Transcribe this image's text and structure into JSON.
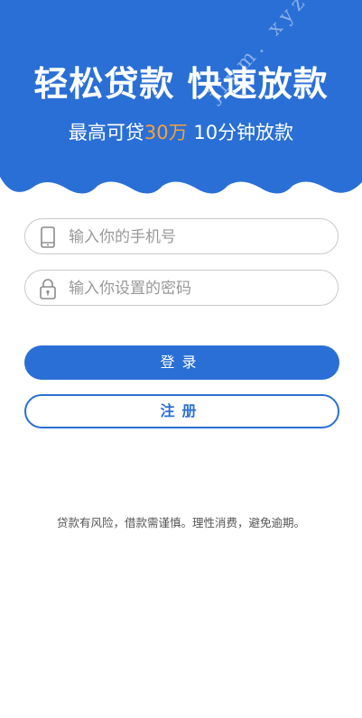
{
  "banner": {
    "headline": "轻松贷款 快速放款",
    "subline_prefix": "最高可贷",
    "subline_amount": "30万",
    "subline_suffix": " 10分钟放款",
    "watermark": "jfym. xyz",
    "color": "#2a6fd6",
    "amount_color": "#f5a23a"
  },
  "form": {
    "phone_placeholder": "输入你的手机号",
    "password_placeholder": "输入你设置的密码",
    "phone_icon": "phone-icon",
    "lock_icon": "lock-icon"
  },
  "buttons": {
    "login_label": "登录",
    "register_label": "注册"
  },
  "notice": "贷款有风险，借款需谨慎。理性消费，避免逾期。"
}
